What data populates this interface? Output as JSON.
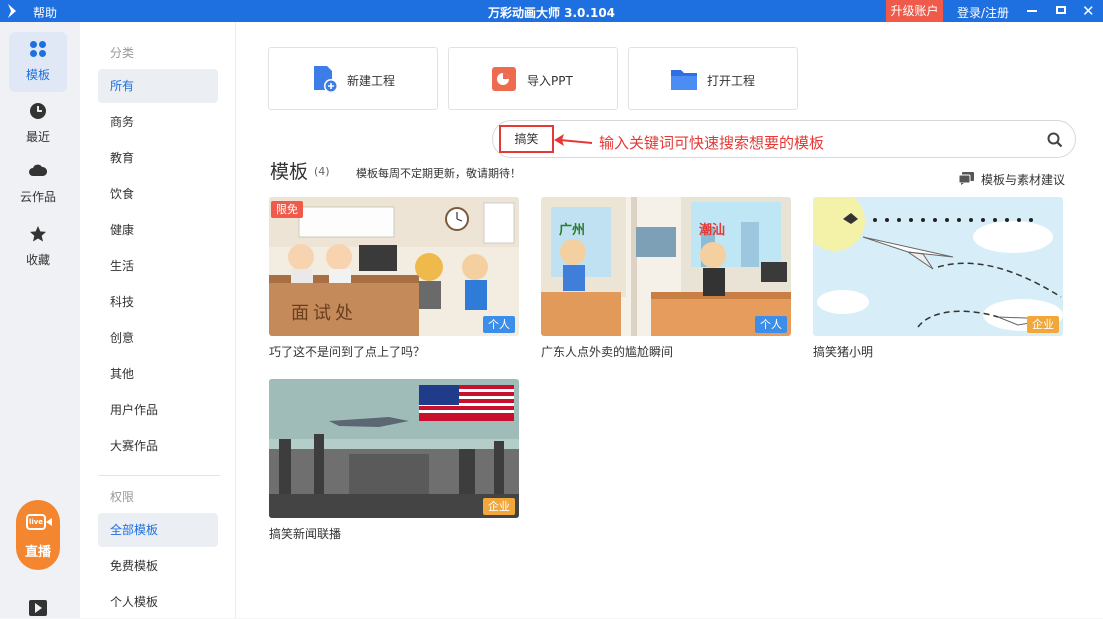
{
  "titlebar": {
    "help": "帮助",
    "title": "万彩动画大师 3.0.104",
    "upgrade": "升级账户",
    "login": "登录/注册"
  },
  "nav": {
    "templates": "模板",
    "recent": "最近",
    "cloud": "云作品",
    "favorites": "收藏",
    "live": "直播",
    "live_badge": "live"
  },
  "categories": {
    "title": "分类",
    "items": [
      "所有",
      "商务",
      "教育",
      "饮食",
      "健康",
      "生活",
      "科技",
      "创意",
      "其他",
      "用户作品",
      "大赛作品"
    ],
    "permission_title": "权限",
    "permission_items": [
      "全部模板",
      "免费模板",
      "个人模板"
    ]
  },
  "actions": {
    "new_project": "新建工程",
    "import_ppt": "导入PPT",
    "open_project": "打开工程"
  },
  "search": {
    "value": "搞笑",
    "annotation": "输入关键词可快速搜索想要的模板"
  },
  "section": {
    "title": "模板",
    "count": "(4)",
    "desc": "模板每周不定期更新，敬请期待！",
    "suggest": "模板与素材建议"
  },
  "templates": [
    {
      "caption": "巧了这不是问到了点上了吗？",
      "tag": "个人",
      "free_tag": "限免",
      "scene_text": "面试处"
    },
    {
      "caption": "广东人点外卖的尴尬瞬间",
      "tag": "个人",
      "scene_left": "广州",
      "scene_right": "潮汕"
    },
    {
      "caption": "搞笑猪小明",
      "tag": "企业"
    },
    {
      "caption": "搞笑新闻联播",
      "tag": "企业"
    }
  ],
  "colors": {
    "accent": "#1e6fe0",
    "upgrade": "#f05a4a",
    "annotation": "#e53935",
    "tag_enterprise": "#f2a73b",
    "tag_personal": "#3d8ee8",
    "live": "#f3862f"
  }
}
